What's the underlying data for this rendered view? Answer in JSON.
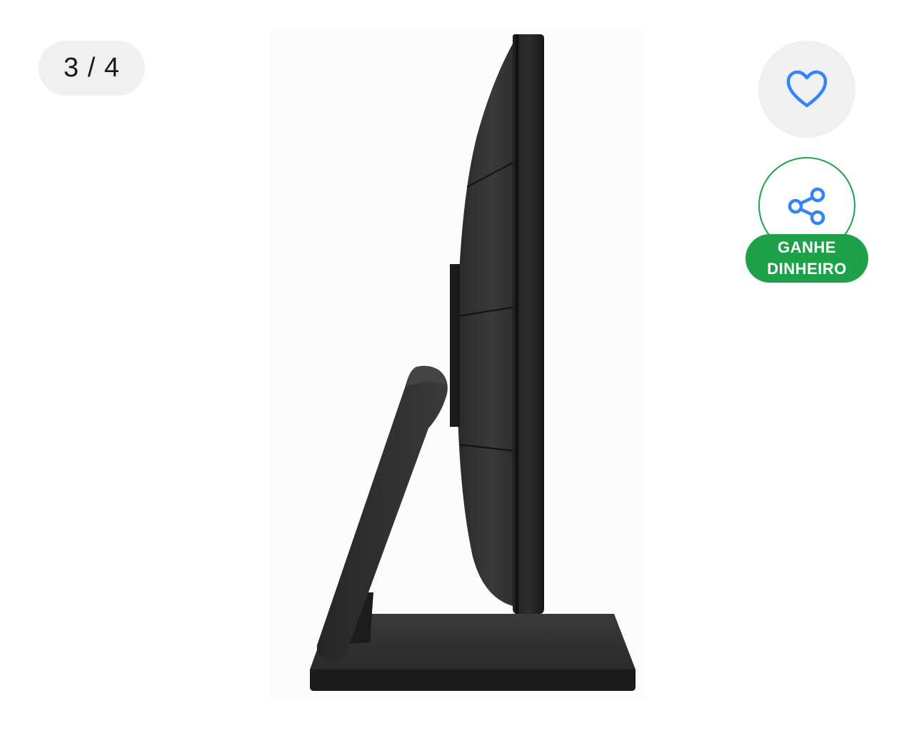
{
  "gallery": {
    "counter": "3 / 4"
  },
  "actions": {
    "favorite_icon": "heart-icon",
    "share_icon": "share-icon",
    "earn_line1": "GANHE",
    "earn_line2": "DINHEIRO"
  },
  "colors": {
    "accent_blue": "#3483fa",
    "earn_green": "#1fa14a",
    "pill_bg": "#f0f0f0"
  }
}
